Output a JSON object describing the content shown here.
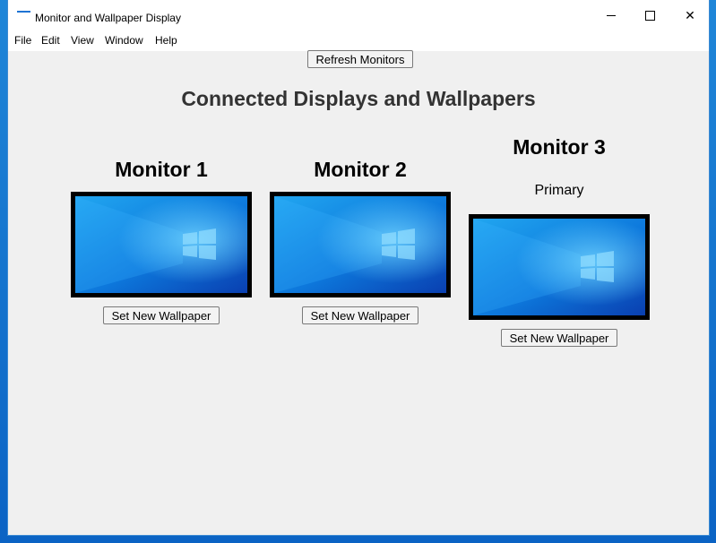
{
  "window": {
    "title": "Monitor and Wallpaper Display",
    "controls": {
      "minimize": "—",
      "maximize": "☐",
      "close": "✕"
    }
  },
  "menu": [
    "File",
    "Edit",
    "View",
    "Window",
    "Help"
  ],
  "toolbar": {
    "refresh_label": "Refresh Monitors"
  },
  "heading": "Connected Displays and Wallpapers",
  "monitors": [
    {
      "name": "Monitor 1",
      "status": "",
      "button": "Set New Wallpaper"
    },
    {
      "name": "Monitor 2",
      "status": "",
      "button": "Set New Wallpaper"
    },
    {
      "name": "Monitor 3",
      "status": "Primary",
      "button": "Set New Wallpaper"
    }
  ],
  "colors": {
    "window_bg": "#f0f0f0",
    "heading": "#333333",
    "wallpaper_dark": "#0a3fb0",
    "wallpaper_light": "#21a6f0"
  }
}
